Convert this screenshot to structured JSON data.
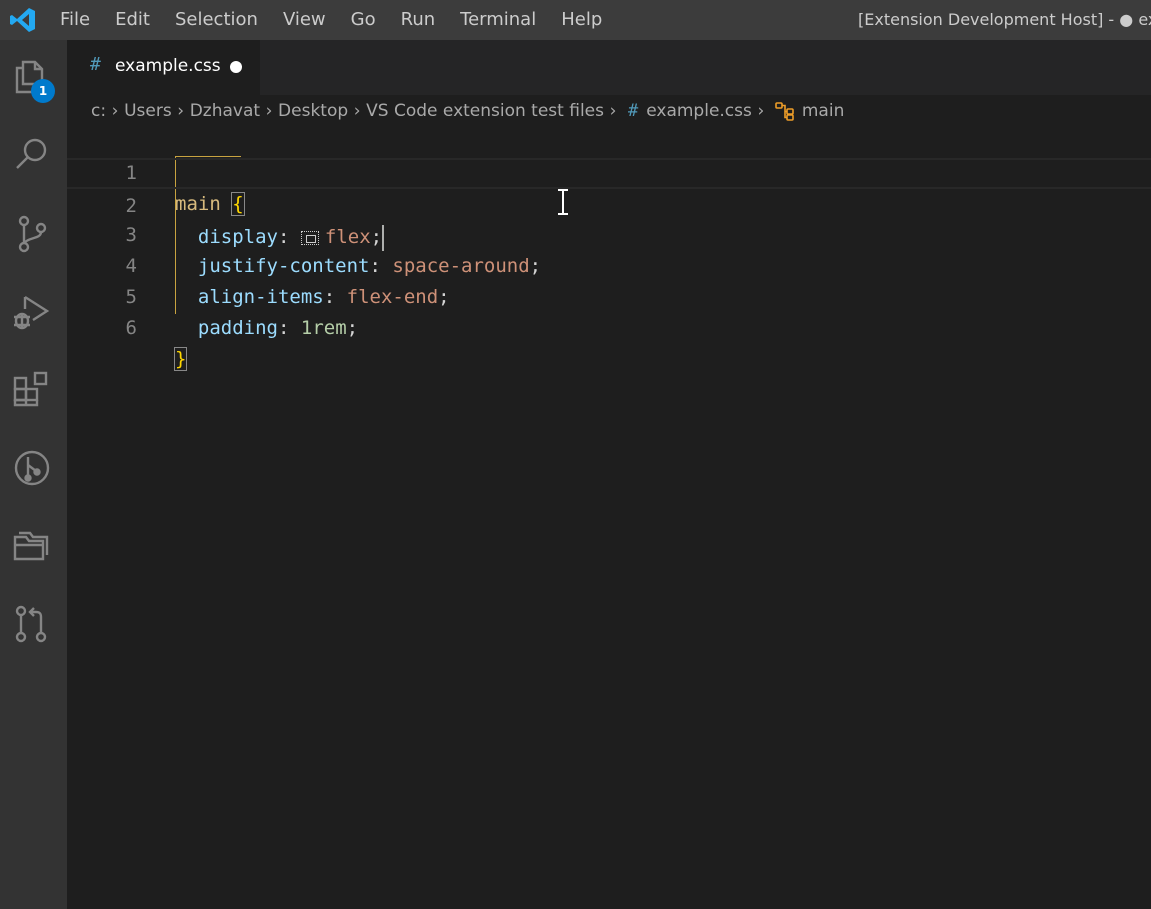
{
  "window": {
    "title": "[Extension Development Host] - ● example.css - VS Code extension test files",
    "menu": [
      "File",
      "Edit",
      "Selection",
      "View",
      "Go",
      "Run",
      "Terminal",
      "Help"
    ]
  },
  "activity_bar": {
    "items": [
      {
        "icon": "files-icon",
        "badge": "1"
      },
      {
        "icon": "search-icon"
      },
      {
        "icon": "source-control-icon"
      },
      {
        "icon": "run-debug-icon"
      },
      {
        "icon": "extensions-icon"
      },
      {
        "icon": "git-graph-icon"
      },
      {
        "icon": "folder-icon"
      },
      {
        "icon": "pull-request-icon"
      }
    ]
  },
  "tab": {
    "icon": "#",
    "label": "example.css",
    "dirty": true
  },
  "breadcrumbs": {
    "parts": [
      "c:",
      "Users",
      "Dzhavat",
      "Desktop",
      "VS Code extension test files"
    ],
    "file_icon": "#",
    "file": "example.css",
    "symbol_icon": "symbol-class-icon",
    "symbol": "main"
  },
  "editor": {
    "line_numbers": [
      "1",
      "2",
      "3",
      "4",
      "5",
      "6"
    ],
    "line1": {
      "selector": "main",
      "open": "{"
    },
    "line2": {
      "prop": "display",
      "colon": ":",
      "value": "flex",
      "semi": ";"
    },
    "line3": {
      "prop": "justify-content",
      "colon": ":",
      "value": "space-around",
      "semi": ";"
    },
    "line4": {
      "prop": "align-items",
      "colon": ":",
      "value": "flex-end",
      "semi": ";"
    },
    "line5": {
      "prop": "padding",
      "colon": ":",
      "value": "1rem",
      "semi": ";"
    },
    "line6": {
      "close": "}"
    }
  },
  "colors": {
    "accent": "#007acc",
    "selector": "#d7ba7d",
    "property": "#9cdcfe",
    "value": "#ce9178",
    "number": "#b5cea8"
  }
}
